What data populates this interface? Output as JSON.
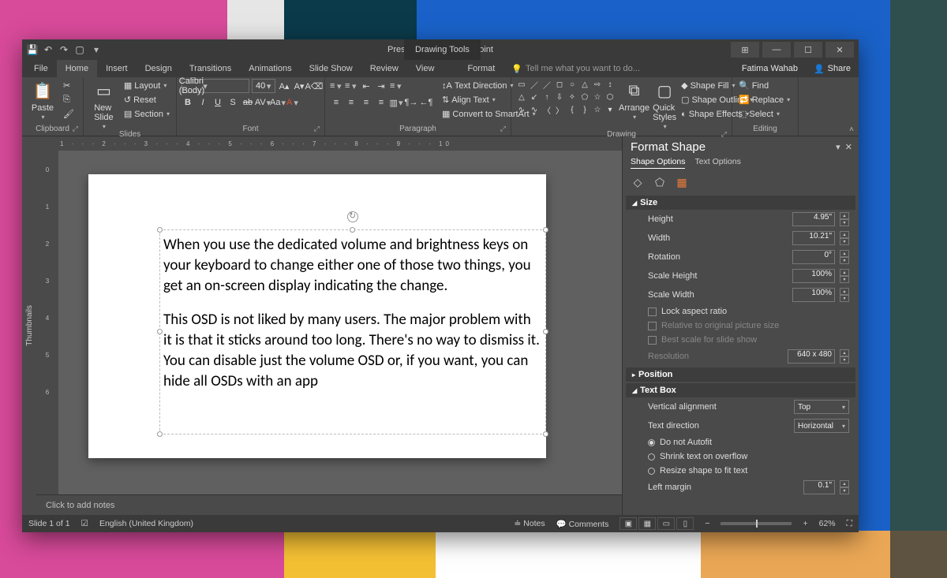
{
  "title": "Presentation1 - PowerPoint",
  "drawing_tools_label": "Drawing Tools",
  "user": "Fatima Wahab",
  "share": "Share",
  "tabs": {
    "file": "File",
    "home": "Home",
    "insert": "Insert",
    "design": "Design",
    "transitions": "Transitions",
    "animations": "Animations",
    "slideshow": "Slide Show",
    "review": "Review",
    "view": "View",
    "format": "Format"
  },
  "tellme_placeholder": "Tell me what you want to do...",
  "ribbon": {
    "clipboard": {
      "label": "Clipboard",
      "paste": "Paste"
    },
    "slides": {
      "label": "Slides",
      "new_slide": "New\nSlide",
      "layout": "Layout",
      "reset": "Reset",
      "section": "Section"
    },
    "font": {
      "label": "Font",
      "name": "Calibri (Body)",
      "size": "40"
    },
    "paragraph": {
      "label": "Paragraph",
      "text_direction": "Text Direction",
      "align_text": "Align Text",
      "smartart": "Convert to SmartArt"
    },
    "drawing": {
      "label": "Drawing",
      "arrange": "Arrange",
      "quick_styles": "Quick\nStyles",
      "shape_fill": "Shape Fill",
      "shape_outline": "Shape Outline",
      "shape_effects": "Shape Effects"
    },
    "editing": {
      "label": "Editing",
      "find": "Find",
      "replace": "Replace",
      "select": "Select"
    }
  },
  "ruler": {
    "h": "1 · · · 2 · · · 3 · · · 4 · · · 5 · · · 6 · · · 7 · · · 8 · · · 9 · · · 10",
    "v": [
      "0",
      "1",
      "2",
      "3",
      "4",
      "5",
      "6"
    ]
  },
  "slide_text": {
    "p1": "When you use the dedicated volume and brightness keys on your keyboard to change either one of those two things, you get an on-screen display indicating the change.",
    "p2": "This OSD is not liked by many users. The major problem with it is that it sticks around too long. There's no way to dismiss it. You can disable just the volume OSD or, if you want, you can hide all OSDs with an app"
  },
  "notes_placeholder": "Click to add notes",
  "format_pane": {
    "title": "Format Shape",
    "shape_options": "Shape Options",
    "text_options": "Text Options",
    "size_label": "Size",
    "height": "Height",
    "height_v": "4.95\"",
    "width": "Width",
    "width_v": "10.21\"",
    "rotation": "Rotation",
    "rotation_v": "0°",
    "scale_h": "Scale Height",
    "scale_h_v": "100%",
    "scale_w": "Scale Width",
    "scale_w_v": "100%",
    "lock": "Lock aspect ratio",
    "rel": "Relative to original picture size",
    "best": "Best scale for slide show",
    "resolution": "Resolution",
    "resolution_v": "640 x 480",
    "position_label": "Position",
    "textbox_label": "Text Box",
    "valign": "Vertical alignment",
    "valign_v": "Top",
    "tdir": "Text direction",
    "tdir_v": "Horizontal",
    "autofit1": "Do not Autofit",
    "autofit2": "Shrink text on overflow",
    "autofit3": "Resize shape to fit text",
    "lmargin": "Left margin",
    "lmargin_v": "0.1\""
  },
  "status": {
    "slide": "Slide 1 of 1",
    "lang": "English (United Kingdom)",
    "notes": "Notes",
    "comments": "Comments",
    "zoom": "62%"
  }
}
